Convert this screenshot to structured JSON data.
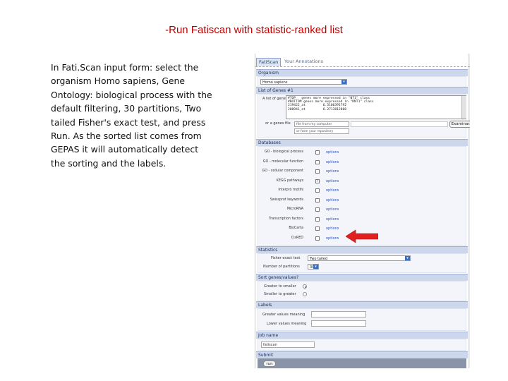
{
  "slide": {
    "title": "-Run Fatiscan with statistic-ranked list",
    "description": "In Fati.Scan input form: select the organism Homo sapiens, Gene Ontology: biological process with the default filtering, 30 partitions, Two tailed Fisher's exact test, and press Run. As the sorted list comes from GEPAS it will automatically detect the sorting and the labels."
  },
  "colors": {
    "title": "#c00000",
    "arrow": "#e02020",
    "section_header": "#ccd7ec",
    "link": "#2b55c6"
  },
  "app": {
    "tabs": [
      {
        "label": "FatiScan",
        "active": true
      },
      {
        "label": "Your Annotations",
        "active": false
      }
    ],
    "organism": {
      "header": "Organism",
      "selected": "Homo sapiens"
    },
    "genes": {
      "header": "List of Genes #1",
      "list_label": "A list of genes",
      "list_lines": [
        "#TOP   genes more expressed in \"NT1\" class",
        "#BOTTOM genes more expressed in \"RNT1\" class",
        "219422_at         6.5106391792",
        "200941_at         6.2713812808"
      ],
      "file_label": "or a genes file",
      "file_placeholder_1": "file from my computer",
      "file_placeholder_2": "or from your repository",
      "browse_label": "Examinar..."
    },
    "databases": {
      "header": "Databases",
      "option_label": "options",
      "rows": [
        {
          "name": "GO - biological process",
          "checked": false
        },
        {
          "name": "GO - molecular function",
          "checked": false
        },
        {
          "name": "GO - cellular component",
          "checked": false
        },
        {
          "name": "KEGG pathways",
          "checked": true
        },
        {
          "name": "Interpro motifs",
          "checked": false
        },
        {
          "name": "Swissprot keywords",
          "checked": false
        },
        {
          "name": "MicroRNA",
          "checked": false
        },
        {
          "name": "Transcription factors",
          "checked": false
        },
        {
          "name": "BioCarta",
          "checked": false
        },
        {
          "name": "CisRED",
          "checked": false
        }
      ]
    },
    "statistics": {
      "header": "Statistics",
      "test_label": "Fisher exact test",
      "test_value": "Two tailed",
      "partitions_label": "Number of partitions",
      "partitions_value": "30"
    },
    "sort": {
      "header": "Sort genes/values?",
      "greater_label": "Greater to smaller",
      "smaller_label": "Smaller to greater"
    },
    "labels": {
      "header": "Labels",
      "higher_label": "Greater values meaning",
      "lower_label": "Lower values meaning"
    },
    "job": {
      "header": "Job name",
      "value": "fatiscan"
    },
    "submit": {
      "header": "Submit",
      "button_label": "run"
    }
  }
}
